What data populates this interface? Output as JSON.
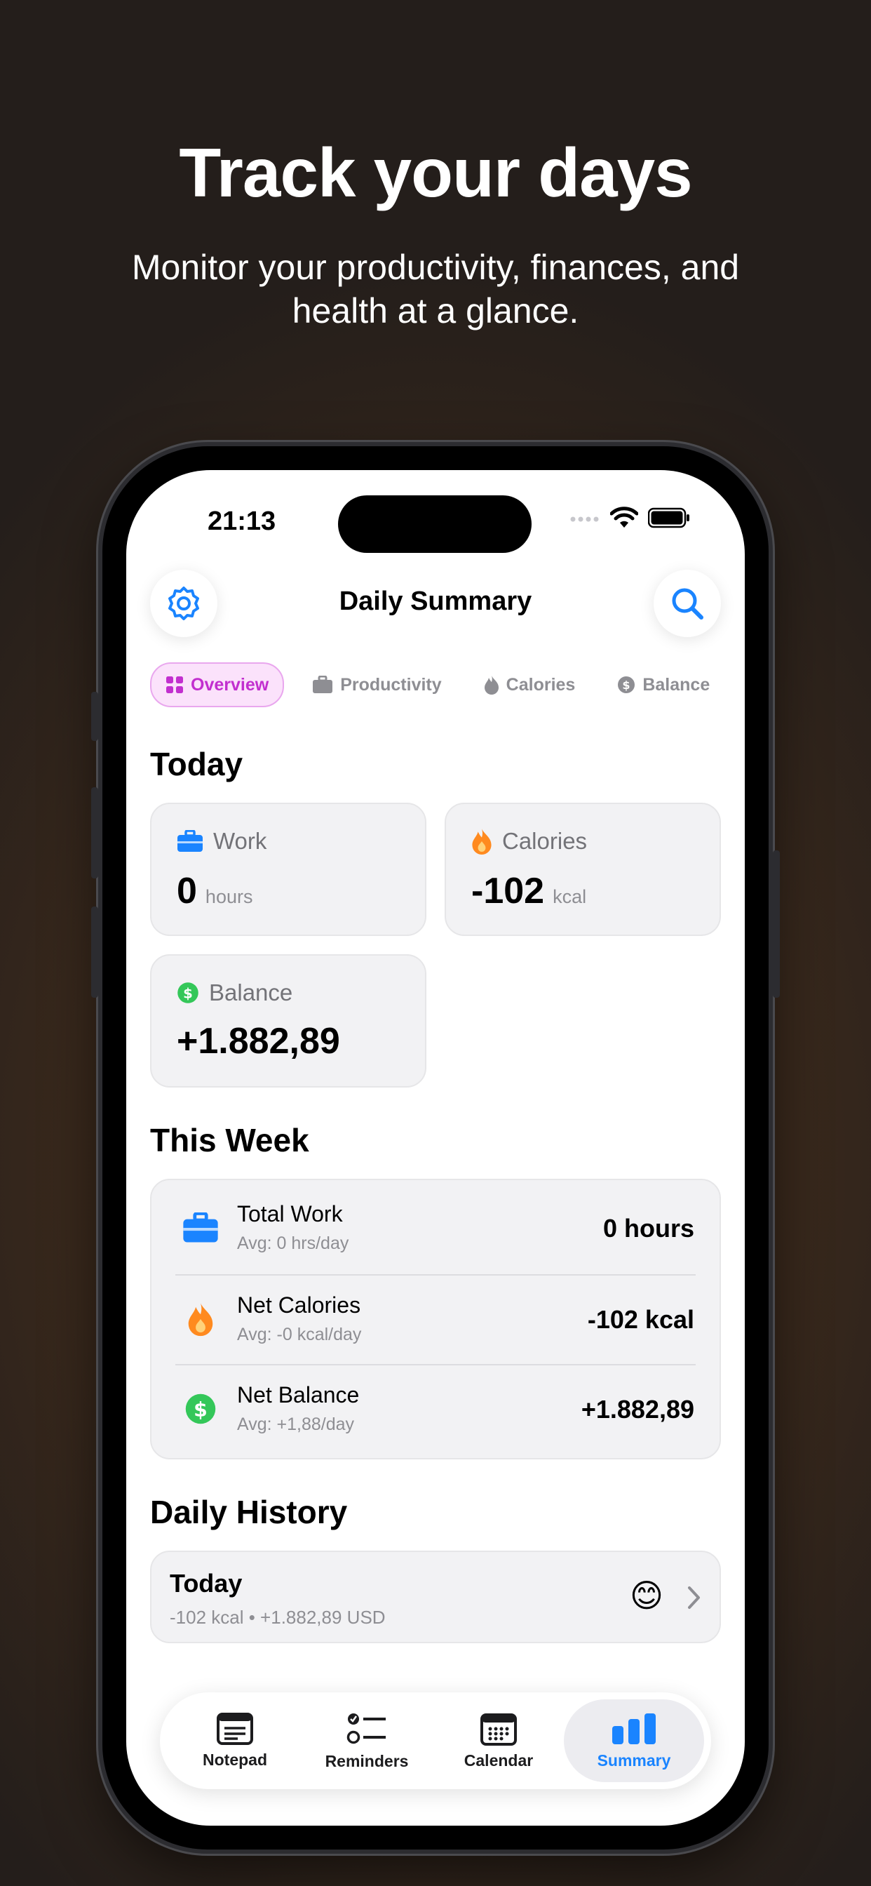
{
  "hero": {
    "title": "Track your days",
    "subtitle": "Monitor your productivity, finances, and health at a glance."
  },
  "status_bar": {
    "time": "21:13"
  },
  "header": {
    "title": "Daily Summary",
    "settings_icon": "gear-icon",
    "search_icon": "search-icon"
  },
  "tabs": [
    {
      "label": "Overview",
      "icon": "grid-icon",
      "active": true
    },
    {
      "label": "Productivity",
      "icon": "briefcase-icon"
    },
    {
      "label": "Calories",
      "icon": "flame-icon"
    },
    {
      "label": "Balance",
      "icon": "dollar-icon"
    }
  ],
  "today": {
    "heading": "Today",
    "work": {
      "label": "Work",
      "value": "0",
      "unit": "hours"
    },
    "calories": {
      "label": "Calories",
      "value": "-102",
      "unit": "kcal"
    },
    "balance": {
      "label": "Balance",
      "value": "+1.882,89"
    }
  },
  "week": {
    "heading": "This Week",
    "rows": [
      {
        "title": "Total Work",
        "sub": "Avg: 0 hrs/day",
        "value": "0 hours",
        "icon": "briefcase-icon"
      },
      {
        "title": "Net Calories",
        "sub": "Avg: -0 kcal/day",
        "value": "-102 kcal",
        "icon": "flame-icon"
      },
      {
        "title": "Net Balance",
        "sub": "Avg: +1,88/day",
        "value": "+1.882,89",
        "icon": "dollar-icon"
      }
    ]
  },
  "history": {
    "heading": "Daily History",
    "items": [
      {
        "title": "Today",
        "sub": "-102 kcal • +1.882,89 USD",
        "emoji": "😊"
      }
    ]
  },
  "tabbar": [
    {
      "label": "Notepad",
      "icon": "notepad-icon"
    },
    {
      "label": "Reminders",
      "icon": "list-icon"
    },
    {
      "label": "Calendar",
      "icon": "calendar-icon"
    },
    {
      "label": "Summary",
      "icon": "chart-icon",
      "active": true
    }
  ],
  "colors": {
    "accent": "#1a84ff",
    "active_tab": "#c22fcf",
    "orange": "#ff8a1f",
    "green": "#34c759",
    "blue": "#1a84ff"
  }
}
